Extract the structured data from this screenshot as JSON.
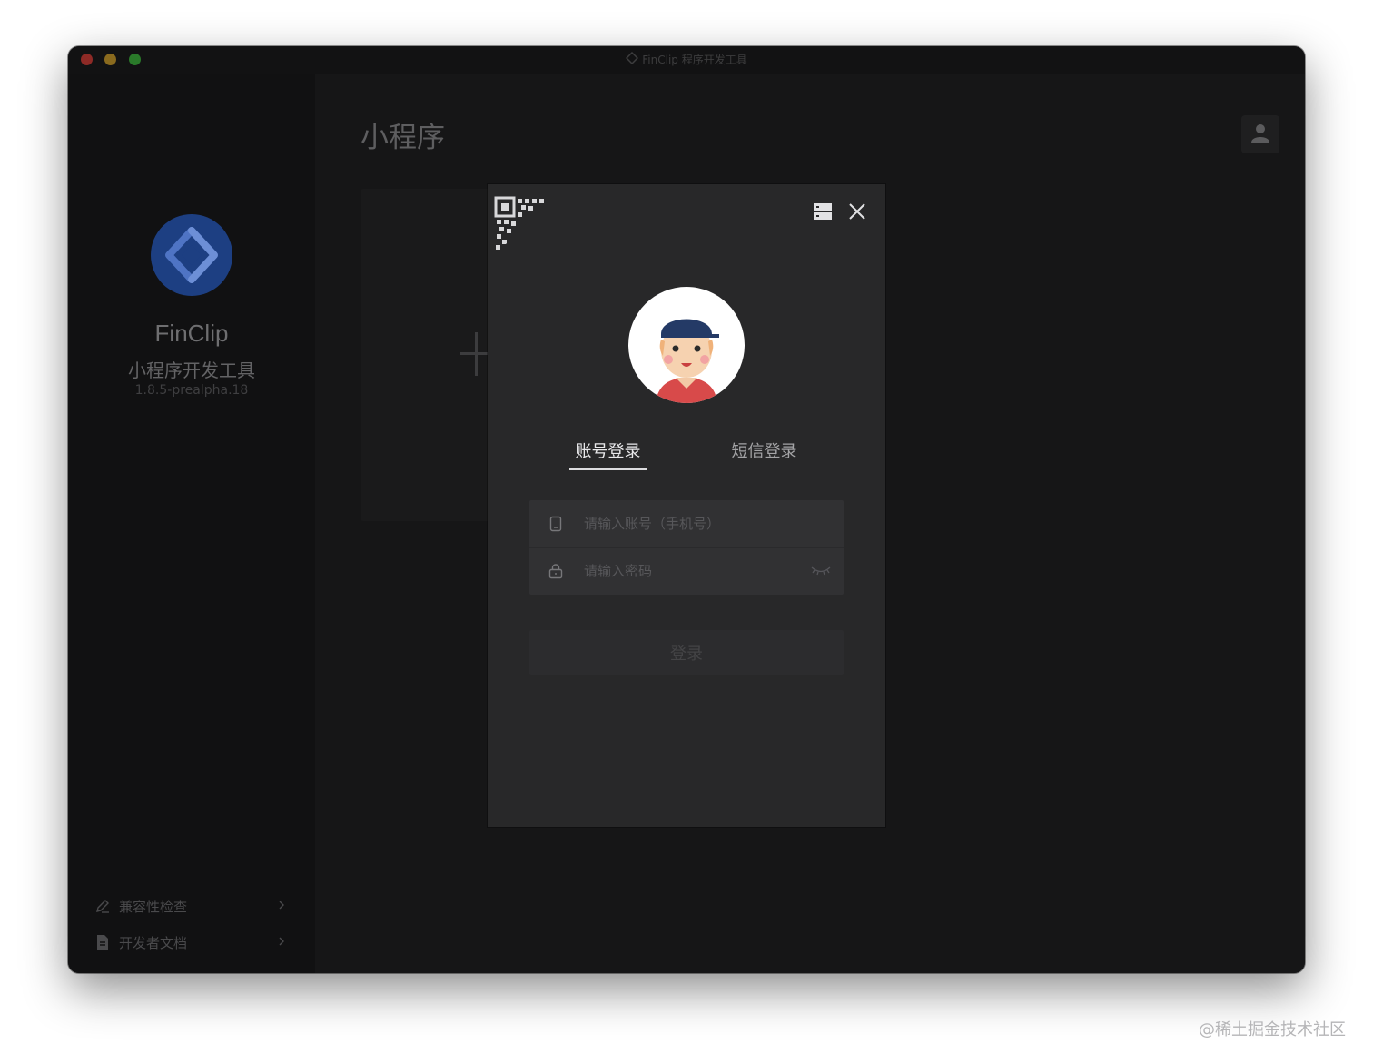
{
  "window": {
    "title": "FinClip 程序开发工具"
  },
  "sidebar": {
    "app_name": "FinClip",
    "app_subtitle": "小程序开发工具",
    "version": "1.8.5-prealpha.18",
    "links": [
      {
        "label": "兼容性检查",
        "icon": "pen-icon"
      },
      {
        "label": "开发者文档",
        "icon": "document-icon"
      }
    ]
  },
  "main": {
    "title": "小程序"
  },
  "login_modal": {
    "tabs": [
      {
        "label": "账号登录",
        "active": true
      },
      {
        "label": "短信登录",
        "active": false
      }
    ],
    "account_placeholder": "请输入账号（手机号）",
    "password_placeholder": "请输入密码",
    "login_label": "登录"
  },
  "watermark": "@稀土掘金技术社区",
  "colors": {
    "brand_blue": "#1d3f82",
    "window_bg": "#1b1b1c",
    "modal_bg": "#282829"
  }
}
